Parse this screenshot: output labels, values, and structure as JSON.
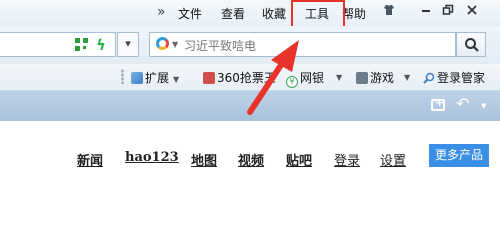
{
  "menubar": {
    "chevron": "»",
    "items": [
      "文件",
      "查看",
      "收藏",
      "工具",
      "帮助"
    ],
    "highlighted": "工具",
    "window_buttons": [
      "skin-icon",
      "minimize-icon",
      "restore-icon",
      "close-icon"
    ]
  },
  "addressbar": {
    "icons": [
      "qr-code-icon",
      "lightning-icon"
    ],
    "dropdown": "▾"
  },
  "search": {
    "placeholder": "习近平致唁电",
    "button_icon": "search-icon"
  },
  "bookmarks": [
    {
      "label": "扩展",
      "icon": "extension-icon",
      "has_dropdown": true
    },
    {
      "label": "360抢票王",
      "icon": "ticket-icon",
      "has_dropdown": false
    },
    {
      "label": "网银",
      "icon": "bank-icon",
      "has_dropdown": true
    },
    {
      "label": "游戏",
      "icon": "game-icon",
      "has_dropdown": true
    },
    {
      "label": "登录管家",
      "icon": "login-manager-icon",
      "has_dropdown": false
    }
  ],
  "tabstrip": {
    "icons": [
      "new-tab-icon",
      "undo-close-icon"
    ]
  },
  "page_nav": {
    "links": [
      "新闻",
      "hao123",
      "地图",
      "视频",
      "贴吧",
      "登录",
      "设置"
    ],
    "more_button": "更多产品"
  },
  "colors": {
    "highlight_box": "#e8322c",
    "more_button": "#3a8ee6",
    "tabstrip": "#b3cbe2"
  }
}
